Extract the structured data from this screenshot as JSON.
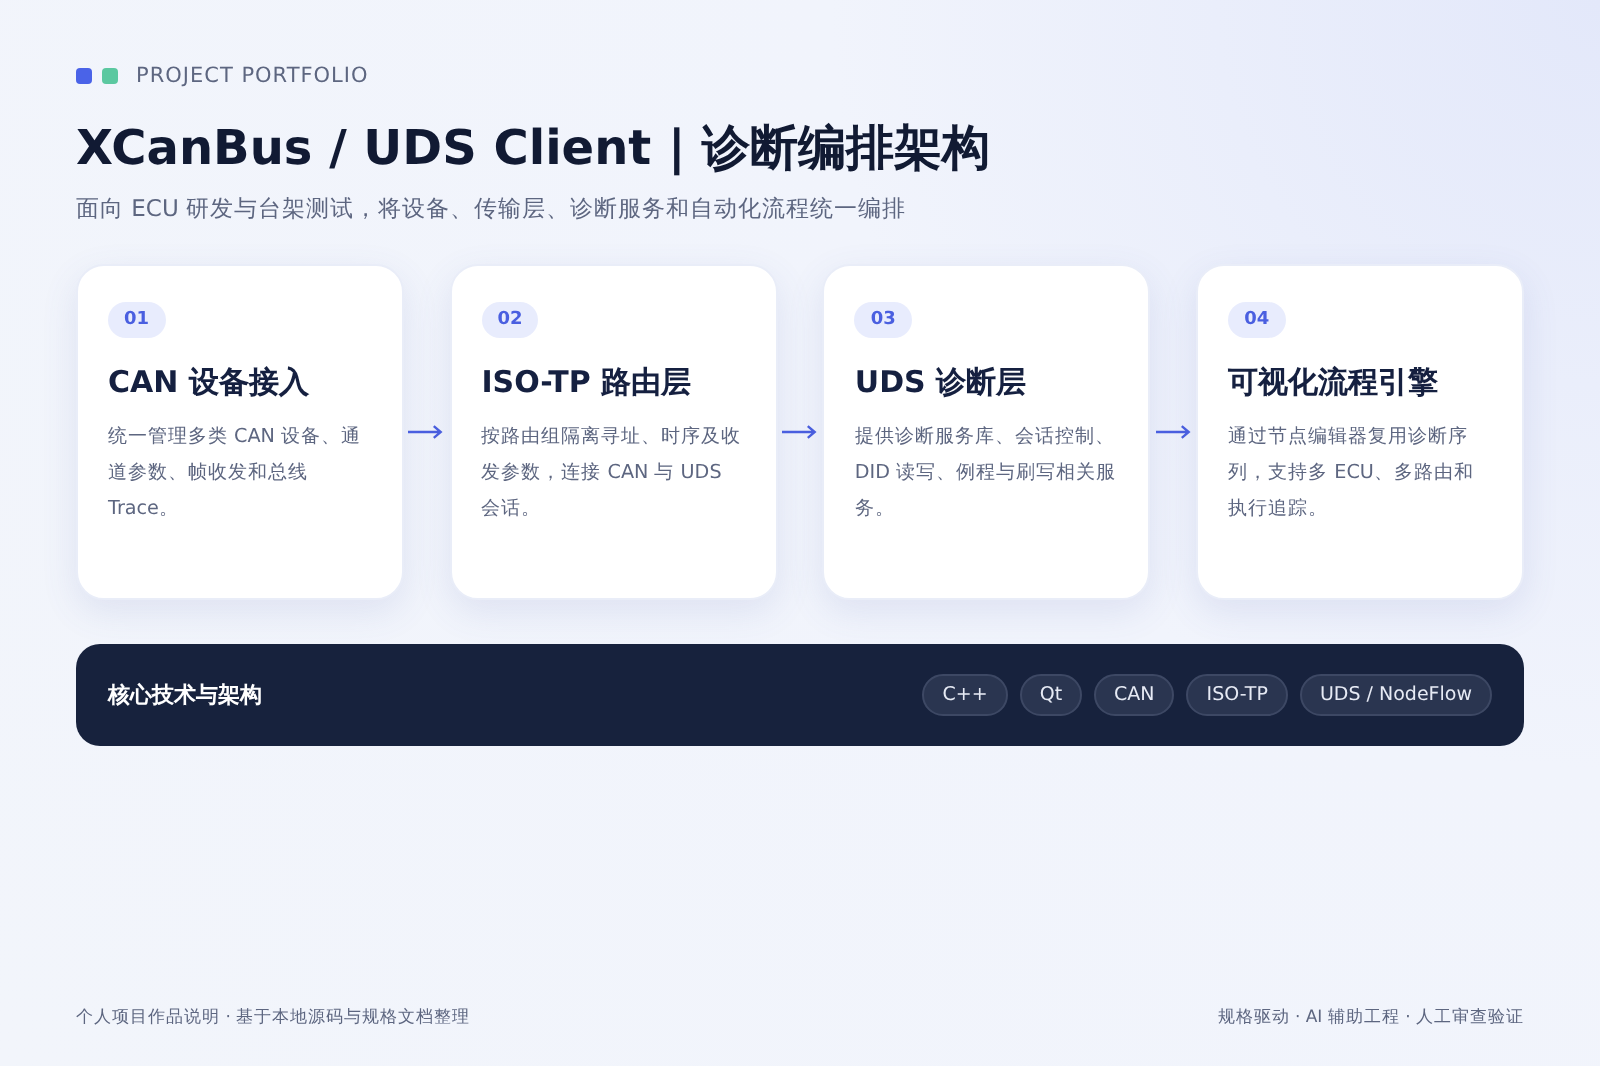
{
  "eyebrow": "PROJECT PORTFOLIO",
  "title": "XCanBus / UDS Client | 诊断编排架构",
  "subtitle": "面向 ECU 研发与台架测试，将设备、传输层、诊断服务和自动化流程统一编排",
  "steps": [
    {
      "number": "01",
      "title": "CAN 设备接入",
      "description": "统一管理多类 CAN 设备、通道参数、帧收发和总线 Trace。"
    },
    {
      "number": "02",
      "title": "ISO-TP 路由层",
      "description": "按路由组隔离寻址、时序及收发参数，连接 CAN 与 UDS 会话。"
    },
    {
      "number": "03",
      "title": "UDS 诊断层",
      "description": "提供诊断服务库、会话控制、DID 读写、例程与刷写相关服务。"
    },
    {
      "number": "04",
      "title": "可视化流程引擎",
      "description": "通过节点编辑器复用诊断序列，支持多 ECU、多路由和执行追踪。"
    }
  ],
  "tech_bar": {
    "title": "核心技术与架构",
    "tags": [
      "C++",
      "Qt",
      "CAN",
      "ISO-TP",
      "UDS / NodeFlow"
    ]
  },
  "footer": {
    "left": "个人项目作品说明 · 基于本地源码与规格文档整理",
    "right": "规格驱动 · AI 辅助工程 · 人工审查验证"
  }
}
